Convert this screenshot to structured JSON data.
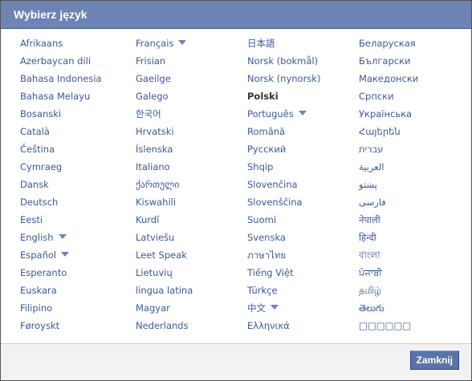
{
  "dialog": {
    "title": "Wybierz język",
    "close_label": "Zamknij"
  },
  "languages": {
    "columns": [
      [
        {
          "label": "Afrikaans"
        },
        {
          "label": "Azerbaycan dili"
        },
        {
          "label": "Bahasa Indonesia"
        },
        {
          "label": "Bahasa Melayu"
        },
        {
          "label": "Bosanski"
        },
        {
          "label": "Català"
        },
        {
          "label": "Čeština"
        },
        {
          "label": "Cymraeg"
        },
        {
          "label": "Dansk"
        },
        {
          "label": "Deutsch"
        },
        {
          "label": "Eesti"
        },
        {
          "label": "English",
          "dropdown": true
        },
        {
          "label": "Español",
          "dropdown": true
        },
        {
          "label": "Esperanto"
        },
        {
          "label": "Euskara"
        },
        {
          "label": "Filipino"
        },
        {
          "label": "Føroyskt"
        }
      ],
      [
        {
          "label": "Français",
          "dropdown": true
        },
        {
          "label": "Frisian"
        },
        {
          "label": "Gaeilge"
        },
        {
          "label": "Galego"
        },
        {
          "label": "한국어"
        },
        {
          "label": "Hrvatski"
        },
        {
          "label": "Íslenska"
        },
        {
          "label": "Italiano"
        },
        {
          "label": "ქართული"
        },
        {
          "label": "Kiswahili"
        },
        {
          "label": "Kurdî"
        },
        {
          "label": "Latviešu"
        },
        {
          "label": "Leet Speak"
        },
        {
          "label": "Lietuvių"
        },
        {
          "label": "lingua latina"
        },
        {
          "label": "Magyar"
        },
        {
          "label": "Nederlands"
        }
      ],
      [
        {
          "label": "日本語"
        },
        {
          "label": "Norsk (bokmål)"
        },
        {
          "label": "Norsk (nynorsk)"
        },
        {
          "label": "Polski",
          "active": true
        },
        {
          "label": "Português",
          "dropdown": true
        },
        {
          "label": "Română"
        },
        {
          "label": "Русский"
        },
        {
          "label": "Shqip"
        },
        {
          "label": "Slovenčina"
        },
        {
          "label": "Slovenščina"
        },
        {
          "label": "Suomi"
        },
        {
          "label": "Svenska"
        },
        {
          "label": "ภาษาไทย"
        },
        {
          "label": "Tiếng Việt"
        },
        {
          "label": "Türkçe"
        },
        {
          "label": "中文",
          "dropdown": true
        },
        {
          "label": "Ελληνικά"
        }
      ],
      [
        {
          "label": "Беларуская"
        },
        {
          "label": "Български"
        },
        {
          "label": "Македонски"
        },
        {
          "label": "Српски"
        },
        {
          "label": "Українська"
        },
        {
          "label": "Հայերեն"
        },
        {
          "label": "עברית"
        },
        {
          "label": "العربية"
        },
        {
          "label": "پښتو"
        },
        {
          "label": "فارسی"
        },
        {
          "label": "नेपाली"
        },
        {
          "label": "हिन्दी"
        },
        {
          "label": "বাংলা"
        },
        {
          "label": "ਪੰਜਾਬੀ"
        },
        {
          "label": "தமிழ்"
        },
        {
          "label": "తెలుగు"
        },
        {
          "label": "□□□□□□"
        }
      ]
    ]
  }
}
